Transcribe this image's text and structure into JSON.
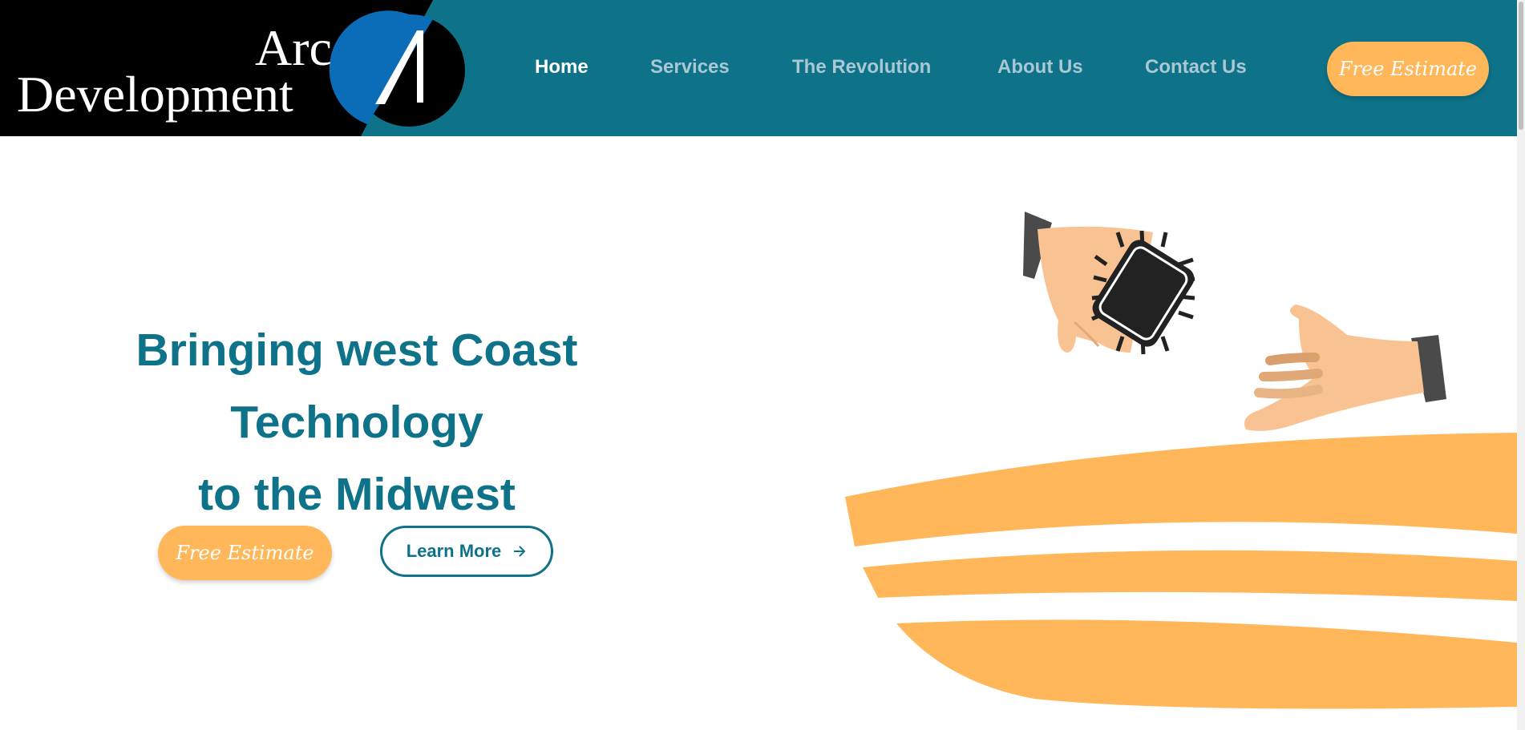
{
  "colors": {
    "primary": "#0e7289",
    "accent": "#ffb75a",
    "white": "#ffffff",
    "nav_inactive": "#a9c8d3",
    "logo_blue": "#0b6db8",
    "logo_black": "#000000"
  },
  "logo": {
    "line1": "Arc",
    "line2": "Development",
    "icon": "arc-a-icon"
  },
  "nav": {
    "items": [
      {
        "label": "Home",
        "active": true
      },
      {
        "label": "Services",
        "active": false
      },
      {
        "label": "The Revolution",
        "active": false
      },
      {
        "label": "About Us",
        "active": false
      },
      {
        "label": "Contact Us",
        "active": false
      }
    ],
    "cta_label": "Free Estimate"
  },
  "hero": {
    "title_lines": [
      "Bringing west Coast",
      "Technology",
      "to the Midwest"
    ],
    "primary_cta": "Free Estimate",
    "secondary_cta": "Learn More",
    "secondary_icon": "arrow-right-icon",
    "illustration": "handshake-chip-illustration"
  }
}
